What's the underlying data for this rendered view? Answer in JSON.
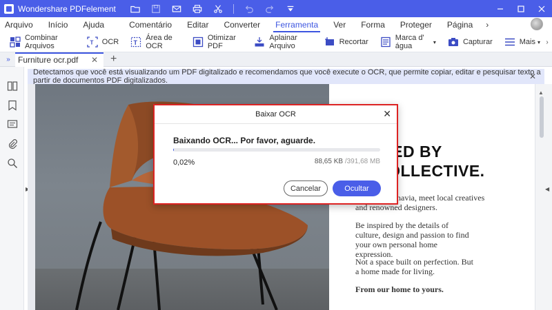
{
  "app": {
    "title": "Wondershare PDFelement",
    "accent": "#4a5ee8"
  },
  "menu": {
    "items": [
      "Arquivo",
      "Início",
      "Ajuda",
      "Comentário",
      "Editar",
      "Converter",
      "Ferramenta",
      "Ver",
      "Forma",
      "Proteger",
      "Página"
    ],
    "active": "Ferramenta",
    "more": "›"
  },
  "toolbar": {
    "combine": "Combinar Arquivos",
    "ocr": "OCR",
    "ocr_area": "Área de OCR",
    "optimize": "Otimizar PDF",
    "flatten": "Aplainar Arquivo",
    "crop": "Recortar",
    "watermark": "Marca d' água",
    "capture": "Capturar",
    "more": "Mais"
  },
  "tabs": {
    "active_file": "Furniture ocr.pdf",
    "close": "✕",
    "add": "+"
  },
  "notice": {
    "text": "Detectamos que você está visualizando um PDF digitalizado e recomendamos que você execute o OCR, que permite copiar, editar e pesquisar texto a partir de documentos PDF digitalizados.",
    "close": "✕"
  },
  "document": {
    "headline1": "RED BY",
    "headline2": "COLLECTIVE.",
    "para1_line1": "navia, meet local creatives",
    "para1_line2": "and renowned designers.",
    "para2": "Be inspired by the details of culture, design and passion to find your own personal home expression.",
    "para3": "Not a space built on perfection. But a home made for living.",
    "para4": "From our home to yours."
  },
  "dialog": {
    "title": "Baixar OCR",
    "close": "✕",
    "message": "Baixando OCR... Por favor, aguarde.",
    "progress_fraction": 0.0002,
    "percent": "0,02%",
    "downloaded": "88,65 KB",
    "total": "/391,68 MB",
    "cancel": "Cancelar",
    "hide": "Ocultar"
  }
}
